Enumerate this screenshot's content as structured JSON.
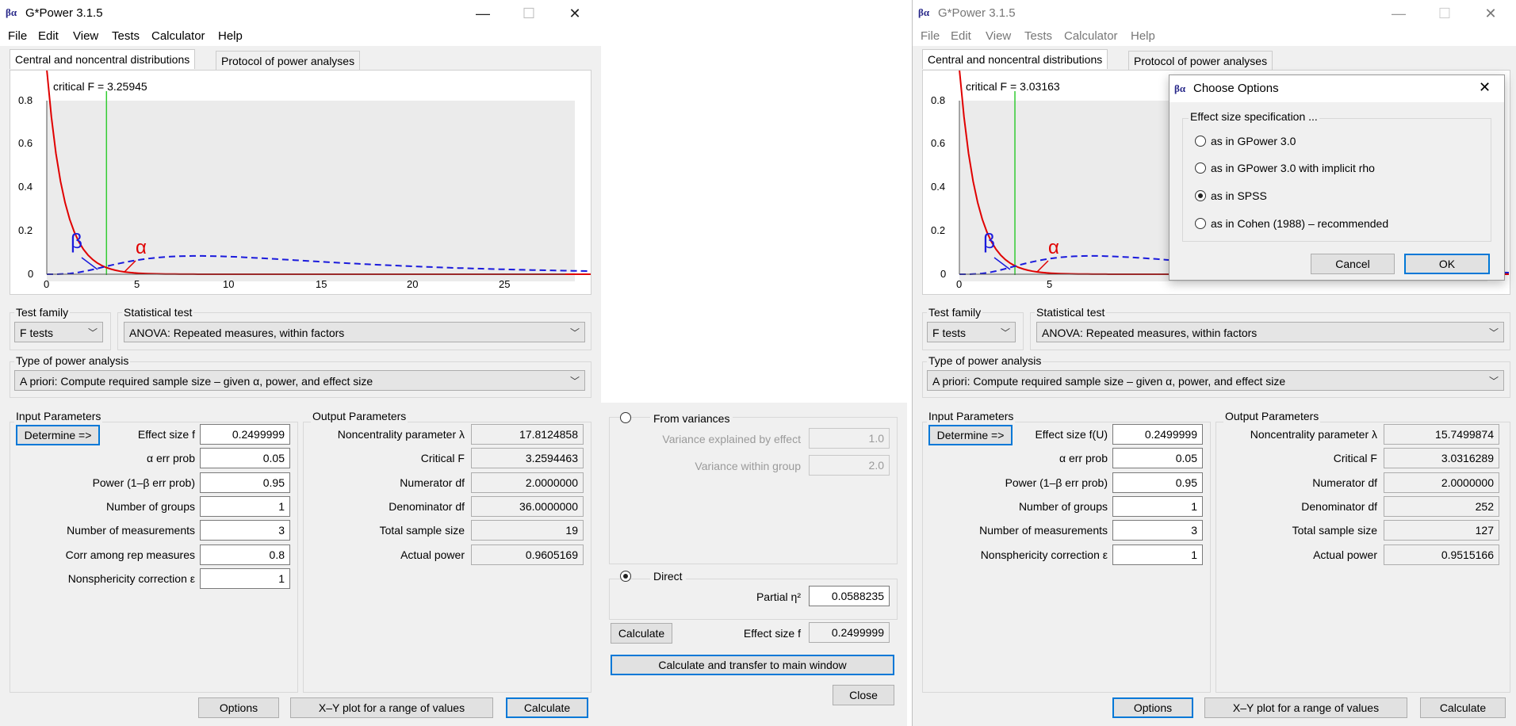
{
  "left_window": {
    "title": "G*Power 3.1.5",
    "logo_text": "βα",
    "menu": [
      "File",
      "Edit",
      "View",
      "Tests",
      "Calculator",
      "Help"
    ],
    "tabs": [
      "Central and noncentral distributions",
      "Protocol of power analyses"
    ],
    "plot": {
      "critical_label": "critical F = 3.25945",
      "beta_symbol": "β",
      "alpha_symbol": "α",
      "y_ticks": [
        "0",
        "0.2",
        "0.4",
        "0.6",
        "0.8"
      ],
      "x_ticks": [
        "0",
        "5",
        "10",
        "15",
        "20",
        "25"
      ],
      "critical_value": 3.25945
    },
    "test_family_label": "Test family",
    "test_family_value": "F tests",
    "statistical_test_label": "Statistical test",
    "statistical_test_value": "ANOVA: Repeated measures, within factors",
    "power_analysis_label": "Type of power analysis",
    "power_analysis_value": "A priori: Compute required sample size – given α, power, and effect size",
    "input_params_label": "Input Parameters",
    "determine_button": "Determine =>",
    "inputs": [
      {
        "label": "Effect size f",
        "value": "0.2499999"
      },
      {
        "label": "α err prob",
        "value": "0.05"
      },
      {
        "label": "Power (1–β err prob)",
        "value": "0.95"
      },
      {
        "label": "Number of groups",
        "value": "1"
      },
      {
        "label": "Number of measurements",
        "value": "3"
      },
      {
        "label": "Corr among rep measures",
        "value": "0.8"
      },
      {
        "label": "Nonsphericity correction ε",
        "value": "1"
      }
    ],
    "output_params_label": "Output Parameters",
    "outputs": [
      {
        "label": "Noncentrality parameter λ",
        "value": "17.8124858"
      },
      {
        "label": "Critical F",
        "value": "3.2594463"
      },
      {
        "label": "Numerator df",
        "value": "2.0000000"
      },
      {
        "label": "Denominator df",
        "value": "36.0000000"
      },
      {
        "label": "Total sample size",
        "value": "19"
      },
      {
        "label": "Actual power",
        "value": "0.9605169"
      }
    ],
    "options_button": "Options",
    "xy_button": "X–Y plot for a range of values",
    "calculate_button": "Calculate"
  },
  "effect_panel": {
    "from_variances_label": "From variances",
    "var_effect_label": "Variance explained by effect",
    "var_effect_value": "1.0",
    "var_within_label": "Variance within group",
    "var_within_value": "2.0",
    "direct_label": "Direct",
    "partial_eta_label": "Partial η²",
    "partial_eta_value": "0.0588235",
    "calculate_button": "Calculate",
    "effect_size_label": "Effect size f",
    "effect_size_value": "0.2499999",
    "transfer_button": "Calculate and transfer to main window",
    "close_button": "Close"
  },
  "right_window": {
    "title": "G*Power 3.1.5",
    "logo_text": "βα",
    "menu": [
      "File",
      "Edit",
      "View",
      "Tests",
      "Calculator",
      "Help"
    ],
    "tabs": [
      "Central and noncentral distributions",
      "Protocol of power analyses"
    ],
    "plot": {
      "critical_label": "critical F = 3.03163",
      "beta_symbol": "β",
      "alpha_symbol": "α",
      "y_ticks": [
        "0",
        "0.2",
        "0.4",
        "0.6",
        "0.8"
      ],
      "x_ticks": [
        "0",
        "5"
      ],
      "critical_value": 3.03163
    },
    "test_family_label": "Test family",
    "test_family_value": "F tests",
    "statistical_test_label": "Statistical test",
    "statistical_test_value": "ANOVA: Repeated measures, within factors",
    "power_analysis_label": "Type of power analysis",
    "power_analysis_value": "A priori: Compute required sample size – given α, power, and effect size",
    "input_params_label": "Input Parameters",
    "determine_button": "Determine =>",
    "inputs": [
      {
        "label": "Effect size f(U)",
        "value": "0.2499999"
      },
      {
        "label": "α err prob",
        "value": "0.05"
      },
      {
        "label": "Power (1–β err prob)",
        "value": "0.95"
      },
      {
        "label": "Number of groups",
        "value": "1"
      },
      {
        "label": "Number of measurements",
        "value": "3"
      },
      {
        "label": "Nonsphericity correction ε",
        "value": "1"
      }
    ],
    "output_params_label": "Output Parameters",
    "outputs": [
      {
        "label": "Noncentrality parameter λ",
        "value": "15.7499874"
      },
      {
        "label": "Critical F",
        "value": "3.0316289"
      },
      {
        "label": "Numerator df",
        "value": "2.0000000"
      },
      {
        "label": "Denominator df",
        "value": "252"
      },
      {
        "label": "Total sample size",
        "value": "127"
      },
      {
        "label": "Actual power",
        "value": "0.9515166"
      }
    ],
    "options_button": "Options",
    "xy_button": "X–Y plot for a range of values",
    "calculate_button": "Calculate"
  },
  "dialog": {
    "title": "Choose Options",
    "group_label": "Effect size specification ...",
    "options": [
      {
        "label": "as in GPower 3.0",
        "selected": false
      },
      {
        "label": "as in GPower 3.0 with implicit rho",
        "selected": false
      },
      {
        "label": "as in SPSS",
        "selected": true
      },
      {
        "label": "as in Cohen (1988) – recommended",
        "selected": false
      }
    ],
    "cancel_button": "Cancel",
    "ok_button": "OK"
  },
  "colors": {
    "central_curve": "#e00000",
    "noncentral_curve": "#1a1adc",
    "critical_line": "#33cc33",
    "focus_border": "#0078d7"
  }
}
